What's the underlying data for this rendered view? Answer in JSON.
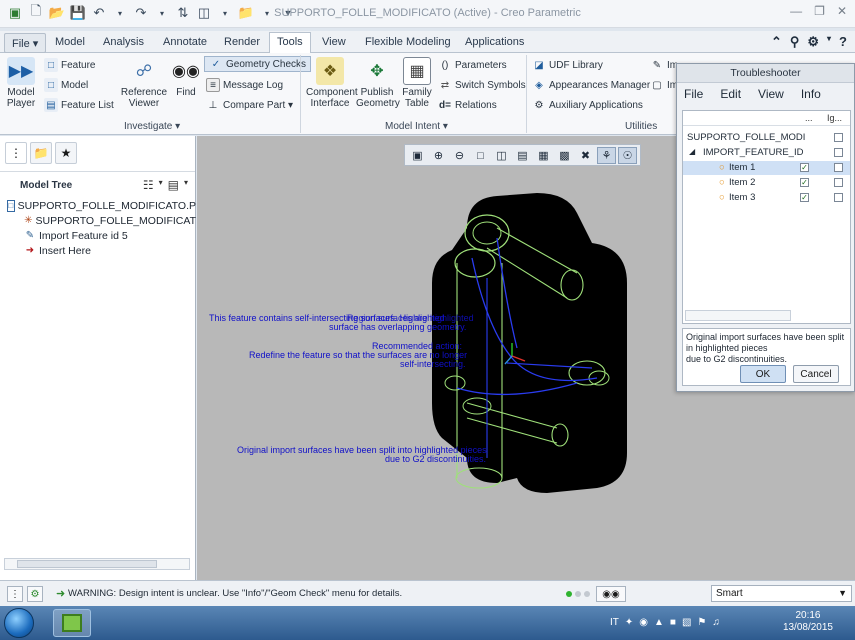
{
  "window": {
    "title": "SUPPORTO_FOLLE_MODIFICATO (Active) - Creo Parametric"
  },
  "tabs": [
    {
      "label": "File ▾"
    },
    {
      "label": "Model"
    },
    {
      "label": "Analysis"
    },
    {
      "label": "Annotate"
    },
    {
      "label": "Render"
    },
    {
      "label": "Tools"
    },
    {
      "label": "View"
    },
    {
      "label": "Flexible Modeling"
    },
    {
      "label": "Applications"
    }
  ],
  "ribbon": {
    "model_player": "Model\nPlayer",
    "feature": "Feature",
    "model": "Model",
    "feature_list": "Feature List",
    "reference_viewer": "Reference\nViewer",
    "find": "Find",
    "geometry_checks": "Geometry Checks",
    "message_log": "Message Log",
    "compare_part": "Compare Part ▾",
    "component_interface": "Component\nInterface",
    "publish_geometry": "Publish\nGeometry",
    "family_table": "Family\nTable",
    "parameters": "Parameters",
    "switch_symbols": "Switch Symbols",
    "relations": "Relations",
    "udf_library": "UDF Library",
    "appearances_manager": "Appearances Manager",
    "auxiliary_applications": "Auxiliary Applications",
    "img_edit": "Im",
    "img2": "Im",
    "groups": {
      "investigate": "Investigate ▾",
      "model_intent": "Model Intent ▾",
      "utilities": "Utilities"
    }
  },
  "model_tree": {
    "title": "Model Tree",
    "items": [
      {
        "label": "SUPPORTO_FOLLE_MODIFICATO.P"
      },
      {
        "label": "SUPPORTO_FOLLE_MODIFICAT"
      },
      {
        "label": "Import Feature id 5"
      },
      {
        "label": "Insert Here"
      }
    ]
  },
  "annotations": {
    "a1_line1": "This feature contains self-intersecting surfaces. Highlighted",
    "a1_line1b": "Region surfaces are highlighted",
    "a1_line2": "surface has overlapping geometry.",
    "a2_line1": "Recommended action:",
    "a2_line2": "Redefine the feature so that the surfaces are no longer",
    "a2_line3": "self-intersecting.",
    "a3_line1": "Original import surfaces have been split into highlighted pieces",
    "a3_line2": "due to G2 discontinuities."
  },
  "troubleshooter": {
    "title": "Troubleshooter",
    "menu": [
      "File",
      "Edit",
      "View",
      "Info"
    ],
    "col_dots": "...",
    "col_ig": "Ig...",
    "root": "SUPPORTO_FOLLE_MODI",
    "node": "IMPORT_FEATURE_ID",
    "items": [
      {
        "label": "Item 1",
        "checked": true
      },
      {
        "label": "Item 2",
        "checked": true
      },
      {
        "label": "Item 3",
        "checked": true
      }
    ],
    "message": "Original import surfaces have been split in highlighted pieces\ndue to G2 discontinuities.",
    "ok": "OK",
    "cancel": "Cancel"
  },
  "status": {
    "message": "WARNING: Design intent is unclear.  Use \"Info\"/\"Geom Check\" menu for details.",
    "filter": "Smart"
  },
  "taskbar": {
    "lang": "IT",
    "time": "20:16",
    "date": "13/08/2015"
  }
}
